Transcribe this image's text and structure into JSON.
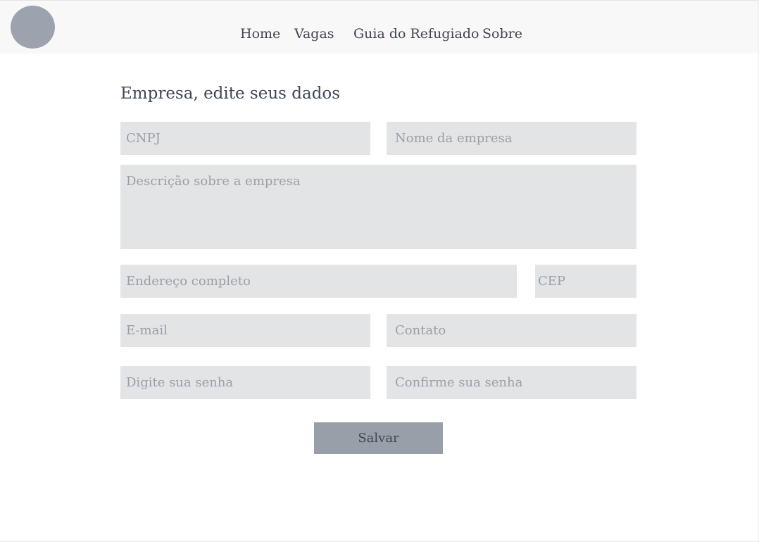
{
  "nav": {
    "links": [
      "Home",
      "Vagas",
      "Guia do Refugiado",
      "Sobre"
    ]
  },
  "form": {
    "title": "Empresa, edite seus dados",
    "fields": {
      "cnpj": {
        "placeholder": "CNPJ",
        "value": ""
      },
      "nome_empresa": {
        "placeholder": "Nome da empresa",
        "value": ""
      },
      "descricao": {
        "placeholder": "Descrição sobre a empresa",
        "value": ""
      },
      "endereco": {
        "placeholder": "Endereço completo",
        "value": ""
      },
      "cep": {
        "placeholder": "CEP",
        "value": ""
      },
      "email": {
        "placeholder": "E-mail",
        "value": ""
      },
      "contato": {
        "placeholder": "Contato",
        "value": ""
      },
      "senha": {
        "placeholder": "Digite sua senha",
        "value": ""
      },
      "confirmar_senha": {
        "placeholder": "Confirme sua senha",
        "value": ""
      }
    },
    "save_label": "Salvar"
  },
  "colors": {
    "header_bg": "#f8f8f8",
    "logo": "#9ca3ae",
    "field_bg": "#e3e4e6",
    "placeholder": "#9aa0a8",
    "text": "#3f4654",
    "button_bg": "#999fa8"
  }
}
